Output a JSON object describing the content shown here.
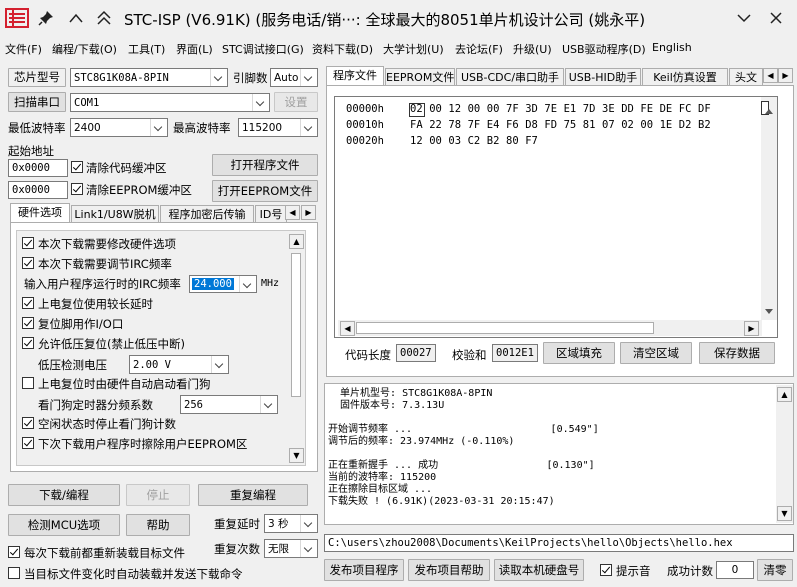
{
  "title": {
    "text": "STC-ISP (V6.91K) (服务电话/销···: 全球最大的8051单片机设计公司 (姚永平)",
    "pin_icon": "pin-icon",
    "collapse_icon": "double-chevron-up-icon",
    "expand_icon": "chevron-down-icon",
    "minimize_icon": "minimize-icon",
    "close_icon": "close-icon"
  },
  "menu": [
    "文件(F)",
    "编程/下载(O)",
    "工具(T)",
    "界面(L)",
    "STC调试接口(G)",
    "资料下载(D)",
    "大学计划(U)",
    "去论坛(F)",
    "升级(U)",
    "USB驱动程序(D)",
    "English"
  ],
  "left": {
    "chip_label": "芯片型号",
    "chip_value": "STC8G1K08A-8PIN",
    "pin_label": "引脚数",
    "pin_value": "Auto",
    "scan_btn": "扫描串口",
    "port_value": "COM1",
    "settings_btn": "设置",
    "min_baud_label": "最低波特率",
    "min_baud_value": "2400",
    "max_baud_label": "最高波特率",
    "max_baud_value": "115200",
    "start_addr_label": "起始地址",
    "addr1_value": "0x0000",
    "clear_code_label": "清除代码缓冲区",
    "open_program_btn": "打开程序文件",
    "addr2_value": "0x0000",
    "clear_eeprom_label": "清除EEPROM缓冲区",
    "open_eeprom_btn": "打开EEPROM文件",
    "tabs": [
      "硬件选项",
      "Link1/U8W脱机",
      "程序加密后传输",
      "ID号"
    ],
    "hw_options": {
      "opt1": "本次下载需要修改硬件选项",
      "opt2": "本次下载需要调节IRC频率",
      "irc_label": "输入用户程序运行时的IRC频率",
      "irc_value": "24.000",
      "irc_unit": "MHz",
      "opt3": "上电复位使用较长延时",
      "opt4": "复位脚用作I/O口",
      "opt5": "允许低压复位(禁止低压中断)",
      "lv_label": "低压检测电压",
      "lv_value": "2.00 V",
      "opt6": "上电复位时由硬件自动启动看门狗",
      "wdt_label": "看门狗定时器分频系数",
      "wdt_value": "256",
      "opt7": "空闲状态时停止看门狗计数",
      "opt8": "下次下载用户程序时擦除用户EEPROM区"
    },
    "download_btn": "下载/编程",
    "stop_btn": "停止",
    "reprogram_btn": "重复编程",
    "detect_btn": "检测MCU选项",
    "help_btn": "帮助",
    "repeat_delay_label": "重复延时",
    "repeat_delay_value": "3 秒",
    "reload_label": "每次下载前都重新装载目标文件",
    "repeat_count_label": "重复次数",
    "repeat_count_value": "无限",
    "auto_send_label": "当目标文件变化时自动装载并发送下载命令"
  },
  "right": {
    "tabs": [
      "程序文件",
      "EEPROM文件",
      "USB-CDC/串口助手",
      "USB-HID助手",
      "Keil仿真设置",
      "头文"
    ],
    "hex_rows": [
      {
        "addr": "00000h",
        "bytes": [
          "02",
          "00",
          "12",
          "00",
          "00",
          "7F",
          "3D",
          "7E",
          "E1",
          "7D",
          "3E",
          "DD",
          "FE",
          "DE",
          "FC",
          "DF"
        ]
      },
      {
        "addr": "00010h",
        "bytes": [
          "FA",
          "22",
          "78",
          "7F",
          "E4",
          "F6",
          "D8",
          "FD",
          "75",
          "81",
          "07",
          "02",
          "00",
          "1E",
          "D2",
          "B2"
        ]
      },
      {
        "addr": "00020h",
        "bytes": [
          "12",
          "00",
          "03",
          "C2",
          "B2",
          "80",
          "F7"
        ]
      }
    ],
    "code_len_label": "代码长度",
    "code_len_value": "00027",
    "checksum_label": "校验和",
    "checksum_value": "0012E1",
    "fill_btn": "区域填充",
    "clear_btn": "清空区域",
    "save_btn": "保存数据",
    "log_lines": [
      "  单片机型号: STC8G1K08A-8PIN",
      "  固件版本号: 7.3.13U",
      "",
      "开始调节频率 ...                       [0.549\"]",
      "调节后的频率: 23.974MHz (-0.110%)",
      "",
      "正在重新握手 ... 成功                  [0.130\"]",
      "当前的波特率: 115200",
      "正在擦除目标区域 ...",
      "下载失败 ! (6.91K)(2023-03-31 20:15:47)"
    ],
    "path": "C:\\users\\zhou2008\\Documents\\KeilProjects\\hello\\Objects\\hello.hex",
    "publish_btn": "发布项目程序",
    "publish_help_btn": "发布项目帮助",
    "read_disk_btn": "读取本机硬盘号",
    "beep_label": "提示音",
    "success_label": "成功计数",
    "success_value": "0",
    "clear_count_btn": "清零"
  },
  "colors": {
    "accent": "#0078d7",
    "logo_red": "#d4202f",
    "selection": "#cce8ff"
  }
}
